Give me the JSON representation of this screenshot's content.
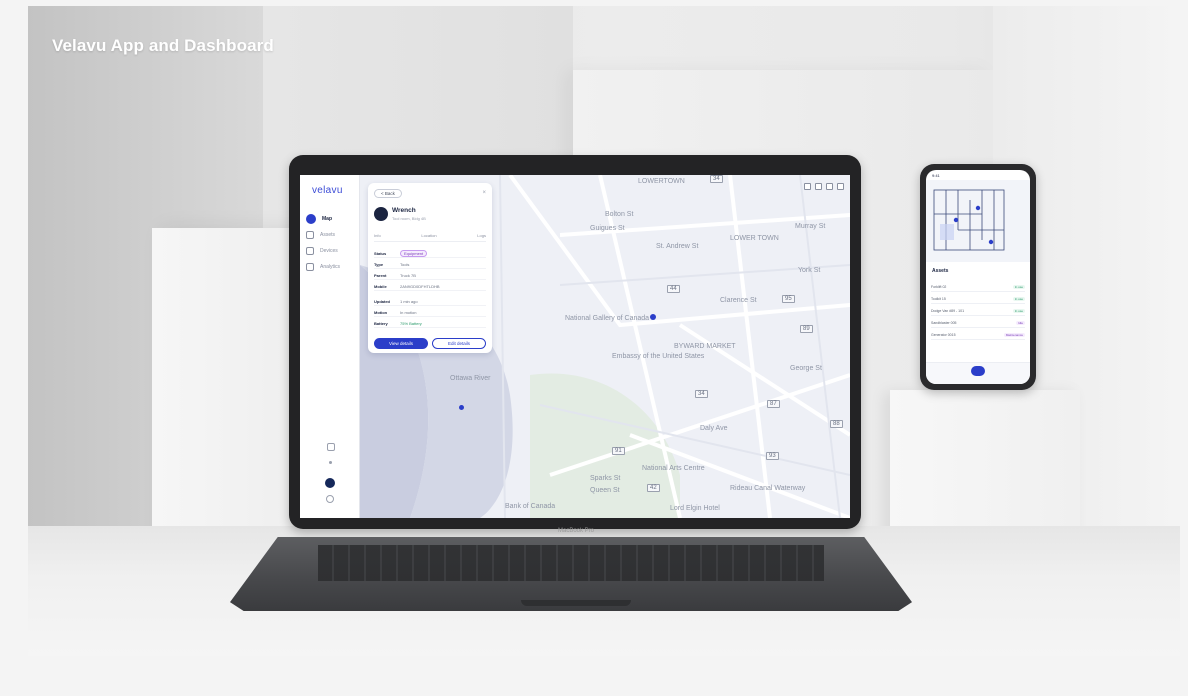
{
  "slide": {
    "title": "Velavu App and Dashboard"
  },
  "laptop": {
    "model_label": "MacBook Pro"
  },
  "dashboard": {
    "brand": "velavu",
    "nav": [
      {
        "label": "Map",
        "icon": "map-icon",
        "active": true
      },
      {
        "label": "Assets",
        "icon": "box-icon",
        "active": false
      },
      {
        "label": "Devices",
        "icon": "device-icon",
        "active": false
      },
      {
        "label": "Analytics",
        "icon": "chart-icon",
        "active": false
      }
    ],
    "asset_card": {
      "back_label": "< Back",
      "name": "Wrench",
      "subtitle": "Tool room, Bldg 4B",
      "tabs": [
        "Info",
        "Location",
        "Logs"
      ],
      "rows": [
        {
          "key": "Status",
          "value": "Equipment",
          "is_pill": true
        },
        {
          "key": "Type",
          "value": "Tools"
        },
        {
          "key": "Parent",
          "value": "Truck 7B"
        },
        {
          "key": "Mobile",
          "value": "2AN9GD0DFHTLDHB"
        },
        {
          "key": "Updated",
          "value": "1 min ago"
        },
        {
          "key": "Motion",
          "value": "In motion"
        },
        {
          "key": "Battery",
          "value": "75% Battery"
        }
      ],
      "primary_button": "View details",
      "secondary_button": "Edit details"
    },
    "map_labels": [
      "LOWERTOWN",
      "Bolton St",
      "Guigues St",
      "St. Andrew St",
      "LOWER TOWN",
      "Murray St",
      "York St",
      "National Gallery of Canada",
      "BYWARD MARKET",
      "Embassy of the United States",
      "Clarence St",
      "George St",
      "Daly Ave",
      "National Arts Centre",
      "Sparks St",
      "Queen St",
      "Bank of Canada",
      "Lord Elgin Hotel",
      "Rideau Canal Waterway",
      "Ottawa River"
    ],
    "road_badges": [
      "34",
      "44",
      "95",
      "89",
      "34",
      "87",
      "88",
      "91",
      "93",
      "42"
    ]
  },
  "phone": {
    "time": "9:41",
    "list_title": "Assets",
    "items": [
      {
        "name": "Forklift 02",
        "tag": "In use"
      },
      {
        "name": "Toolkit 15",
        "tag": "In use"
      },
      {
        "name": "Dodge Van #89 - 101",
        "tag": "In use"
      },
      {
        "name": "Sandblaster 005",
        "tag": "Idle"
      },
      {
        "name": "Generator 0015",
        "tag": "Maintenance"
      }
    ]
  }
}
